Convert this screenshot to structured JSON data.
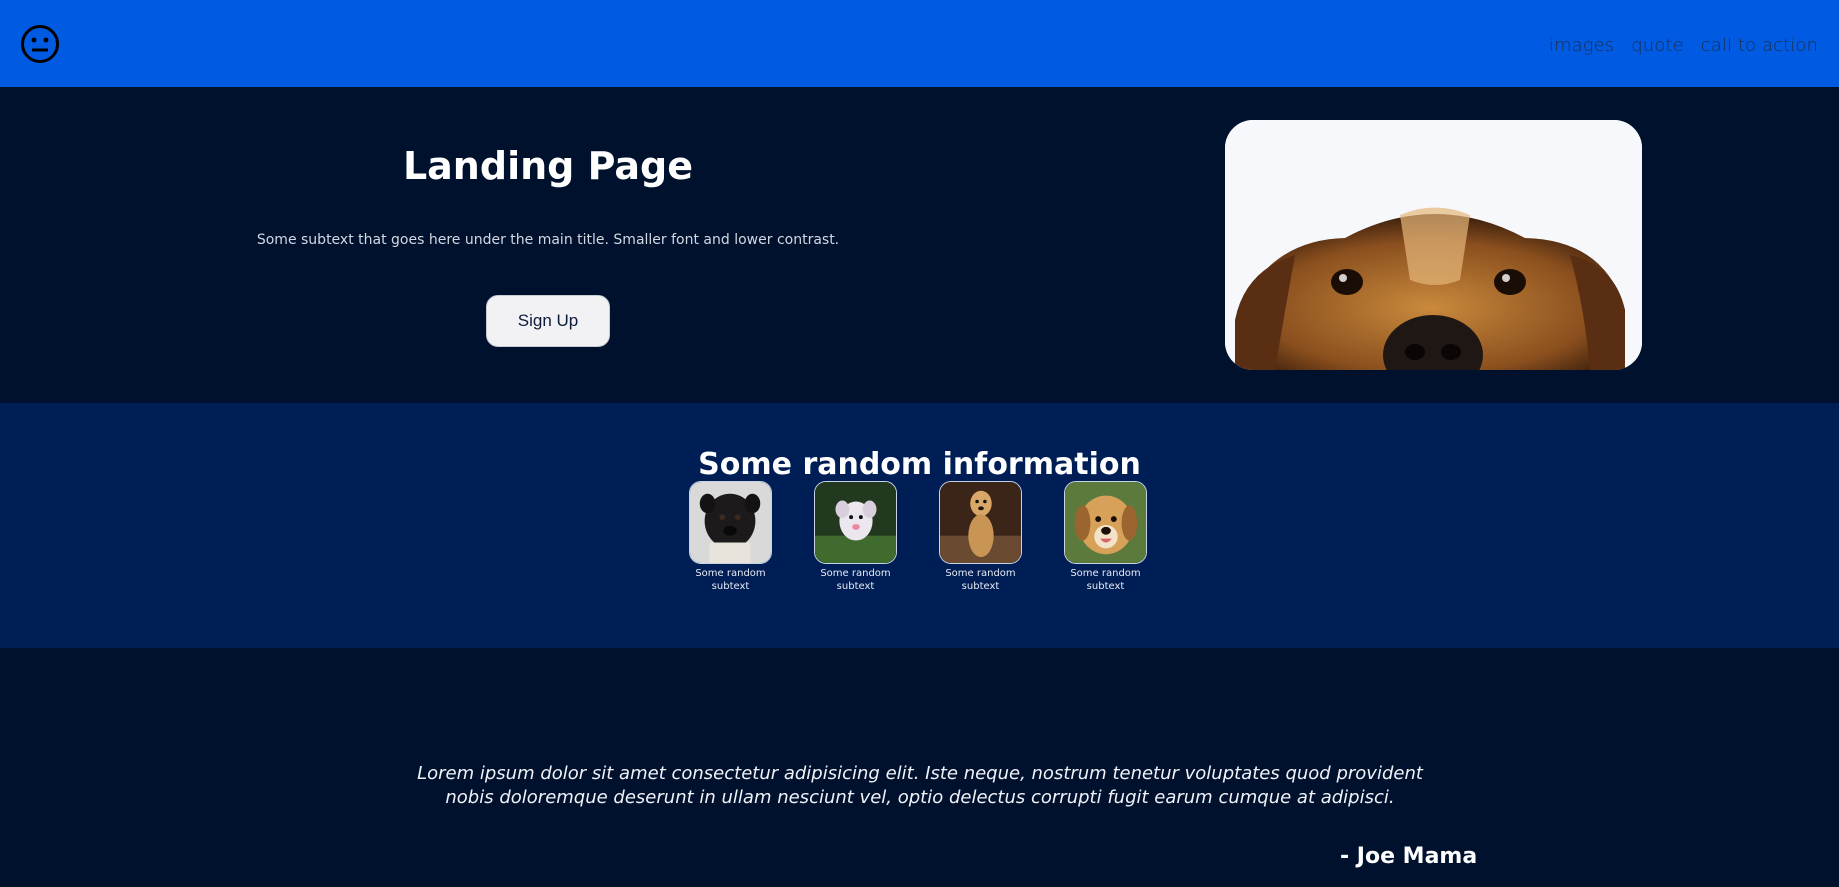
{
  "nav": {
    "logo_icon": "neutral-face-icon",
    "links": [
      "images",
      "quote",
      "call to action"
    ]
  },
  "hero": {
    "title": "Landing Page",
    "subtitle": "Some subtext that goes here under the main title. Smaller font and lower contrast.",
    "signup_label": "Sign Up",
    "image_icon": "dog-face-photo"
  },
  "info": {
    "title": "Some random information",
    "cards": [
      {
        "image": "pug-photo",
        "text": "Some random subtext"
      },
      {
        "image": "white-dog-photo",
        "text": "Some random subtext"
      },
      {
        "image": "golden-dog-photo",
        "text": "Some random subtext"
      },
      {
        "image": "beagle-photo",
        "text": "Some random subtext"
      }
    ]
  },
  "quote": {
    "text": "Lorem ipsum dolor sit amet consectetur adipisicing elit. Iste neque, nostrum tenetur voluptates quod provident nobis doloremque deserunt in ullam nesciunt vel, optio delectus corrupti fugit earum cumque at adipisci.",
    "author": "- Joe Mama"
  },
  "colors": {
    "navbar": "#005ae2",
    "background": "#00112e",
    "info_background": "#001e56"
  }
}
